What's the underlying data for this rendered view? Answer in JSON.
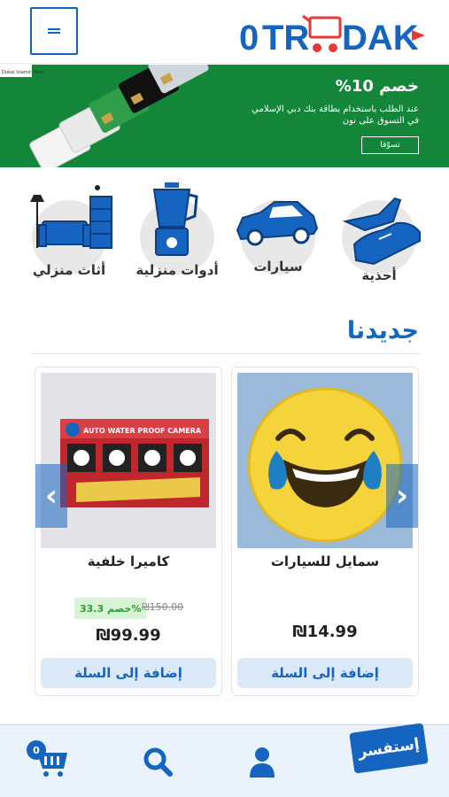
{
  "header": {
    "logo_text": "OTROODAK"
  },
  "banner": {
    "bank_name": "بنك دبي الإسلامي",
    "title": "خصم 10%",
    "text": "عند الطلب باستخدام بطاقة بنك دبي الإسلامي في التسوق على نون",
    "button": "تسوّقا"
  },
  "categories": [
    {
      "label": "أحذية"
    },
    {
      "label": "سيارات"
    },
    {
      "label": "أدوات منزلية"
    },
    {
      "label": "أثاث منزلي"
    }
  ],
  "section": {
    "title": "جديدنا"
  },
  "products": [
    {
      "name": "سمايل للسيارات",
      "price": "₪14.99",
      "add_label": "إضافة إلى السلة"
    },
    {
      "name": "كاميرا خلفية",
      "price": "₪99.99",
      "old_price": "₪150.00",
      "discount": "خصم 33.3%",
      "add_label": "إضافة إلى السلة",
      "box_text": "AUTO WATER PROOF CAMERA"
    }
  ],
  "bottom_bar": {
    "cart_count": "0",
    "ask_label": "إستفسر"
  },
  "colors": {
    "primary": "#1565c0",
    "banner_green": "#14863a",
    "light_blue": "#dce9f8"
  }
}
